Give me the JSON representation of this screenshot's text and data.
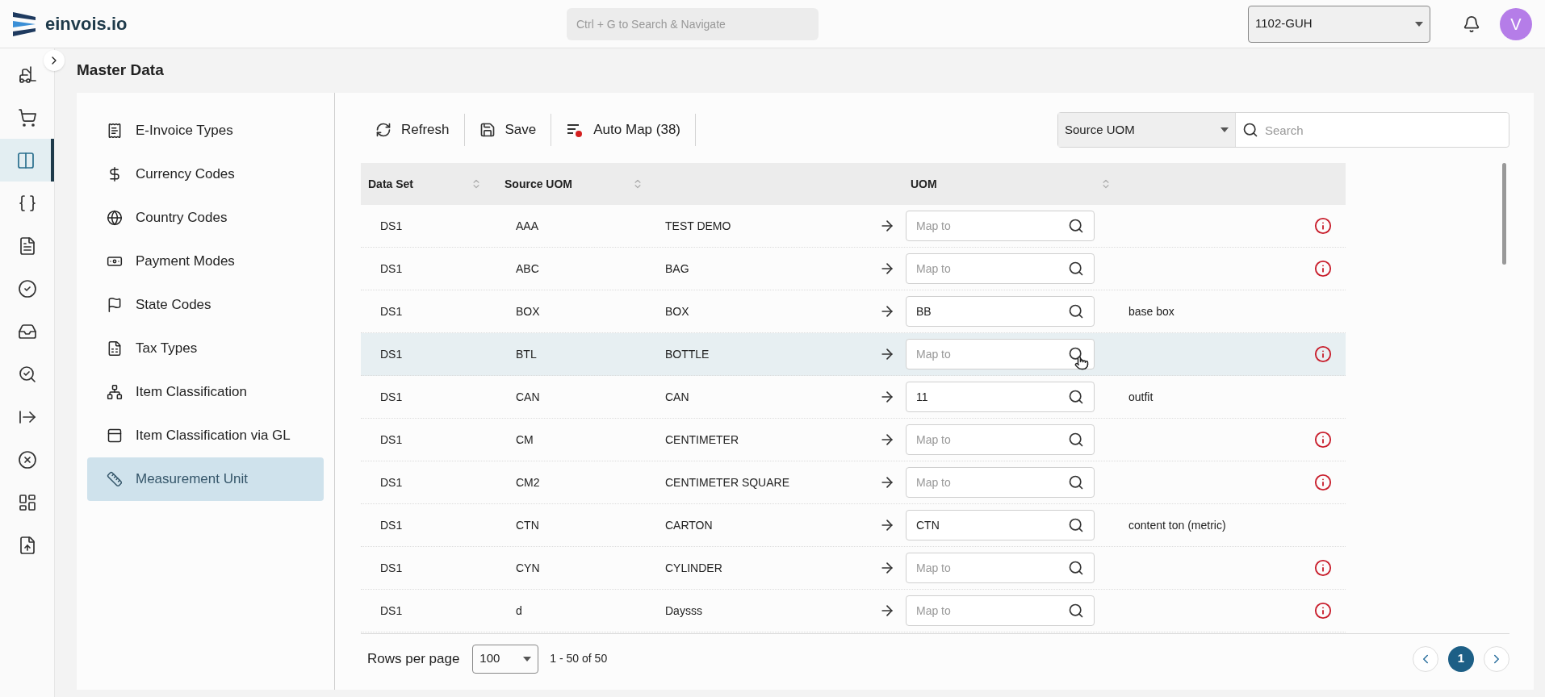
{
  "header": {
    "logo_text": "einvois.io",
    "search": {
      "placeholder": "Ctrl + G to Search & Navigate"
    },
    "company_select": {
      "value": "1102-GUH"
    },
    "avatar": {
      "initial": "V"
    }
  },
  "nav_rail": {
    "items": [
      {
        "selected": false
      },
      {
        "selected": false
      },
      {
        "selected": true
      },
      {
        "selected": false
      },
      {
        "selected": false
      },
      {
        "selected": false
      },
      {
        "selected": false
      },
      {
        "selected": false
      },
      {
        "selected": false
      },
      {
        "selected": false
      },
      {
        "selected": false
      },
      {
        "selected": false
      }
    ]
  },
  "page_title": "Master Data",
  "sidebar": {
    "items": [
      {
        "label": "E-Invoice Types",
        "selected": false
      },
      {
        "label": "Currency Codes",
        "selected": false
      },
      {
        "label": "Country Codes",
        "selected": false
      },
      {
        "label": "Payment Modes",
        "selected": false
      },
      {
        "label": "State Codes",
        "selected": false
      },
      {
        "label": "Tax Types",
        "selected": false
      },
      {
        "label": "Item Classification",
        "selected": false
      },
      {
        "label": "Item Classification via GL",
        "selected": false
      },
      {
        "label": "Measurement Unit",
        "selected": true
      }
    ]
  },
  "toolbar": {
    "buttons": [
      {
        "kind": "refresh",
        "label": "Refresh"
      },
      {
        "kind": "save",
        "label": "Save"
      },
      {
        "kind": "automap",
        "label": "Auto Map (38)"
      }
    ],
    "filter_select": {
      "value": "Source UOM"
    },
    "search": {
      "placeholder": "Search"
    }
  },
  "table": {
    "columns": [
      {
        "label": "Data Set"
      },
      {
        "label": "Source UOM"
      },
      {
        "label": "UOM"
      }
    ],
    "rows": [
      {
        "data_set": "DS1",
        "source_uom": "AAA",
        "description": "TEST DEMO",
        "uom": {
          "placeholder": "Map to"
        },
        "uom_description": null,
        "warning": true,
        "selected": false
      },
      {
        "data_set": "DS1",
        "source_uom": "ABC",
        "description": "BAG",
        "uom": {
          "placeholder": "Map to"
        },
        "warning": true,
        "selected": false
      },
      {
        "data_set": "DS1",
        "source_uom": "BOX",
        "description": "BOX",
        "uom": {
          "value": "BB"
        },
        "uom_description": "base box",
        "warning": false,
        "selected": false
      },
      {
        "data_set": "DS1",
        "source_uom": "BTL",
        "description": "BOTTLE",
        "uom": {
          "placeholder": "Map to"
        },
        "warning": true,
        "selected": true
      },
      {
        "data_set": "DS1",
        "source_uom": "CAN",
        "description": "CAN",
        "uom": {
          "value": "11"
        },
        "uom_description": "outfit",
        "warning": false,
        "selected": false
      },
      {
        "data_set": "DS1",
        "source_uom": "CM",
        "description": "CENTIMETER",
        "uom": {
          "placeholder": "Map to"
        },
        "warning": true,
        "selected": false
      },
      {
        "data_set": "DS1",
        "source_uom": "CM2",
        "description": "CENTIMETER SQUARE",
        "uom": {
          "placeholder": "Map to"
        },
        "warning": true,
        "selected": false
      },
      {
        "data_set": "DS1",
        "source_uom": "CTN",
        "description": "CARTON",
        "uom": {
          "value": "CTN"
        },
        "uom_description": "content ton (metric)",
        "warning": false,
        "selected": false
      },
      {
        "data_set": "DS1",
        "source_uom": "CYN",
        "description": "CYLINDER",
        "uom": {
          "placeholder": "Map to"
        },
        "warning": true,
        "selected": false
      },
      {
        "data_set": "DS1",
        "source_uom": "d",
        "description": "Daysss",
        "uom": {
          "placeholder": "Map to"
        },
        "warning": true,
        "selected": false
      }
    ]
  },
  "footer": {
    "rows_per_page_label": "Rows per page",
    "rows_per_page": "100",
    "range": "1 - 50 of 50",
    "pages": [
      {
        "label": "1",
        "selected": true
      }
    ]
  }
}
